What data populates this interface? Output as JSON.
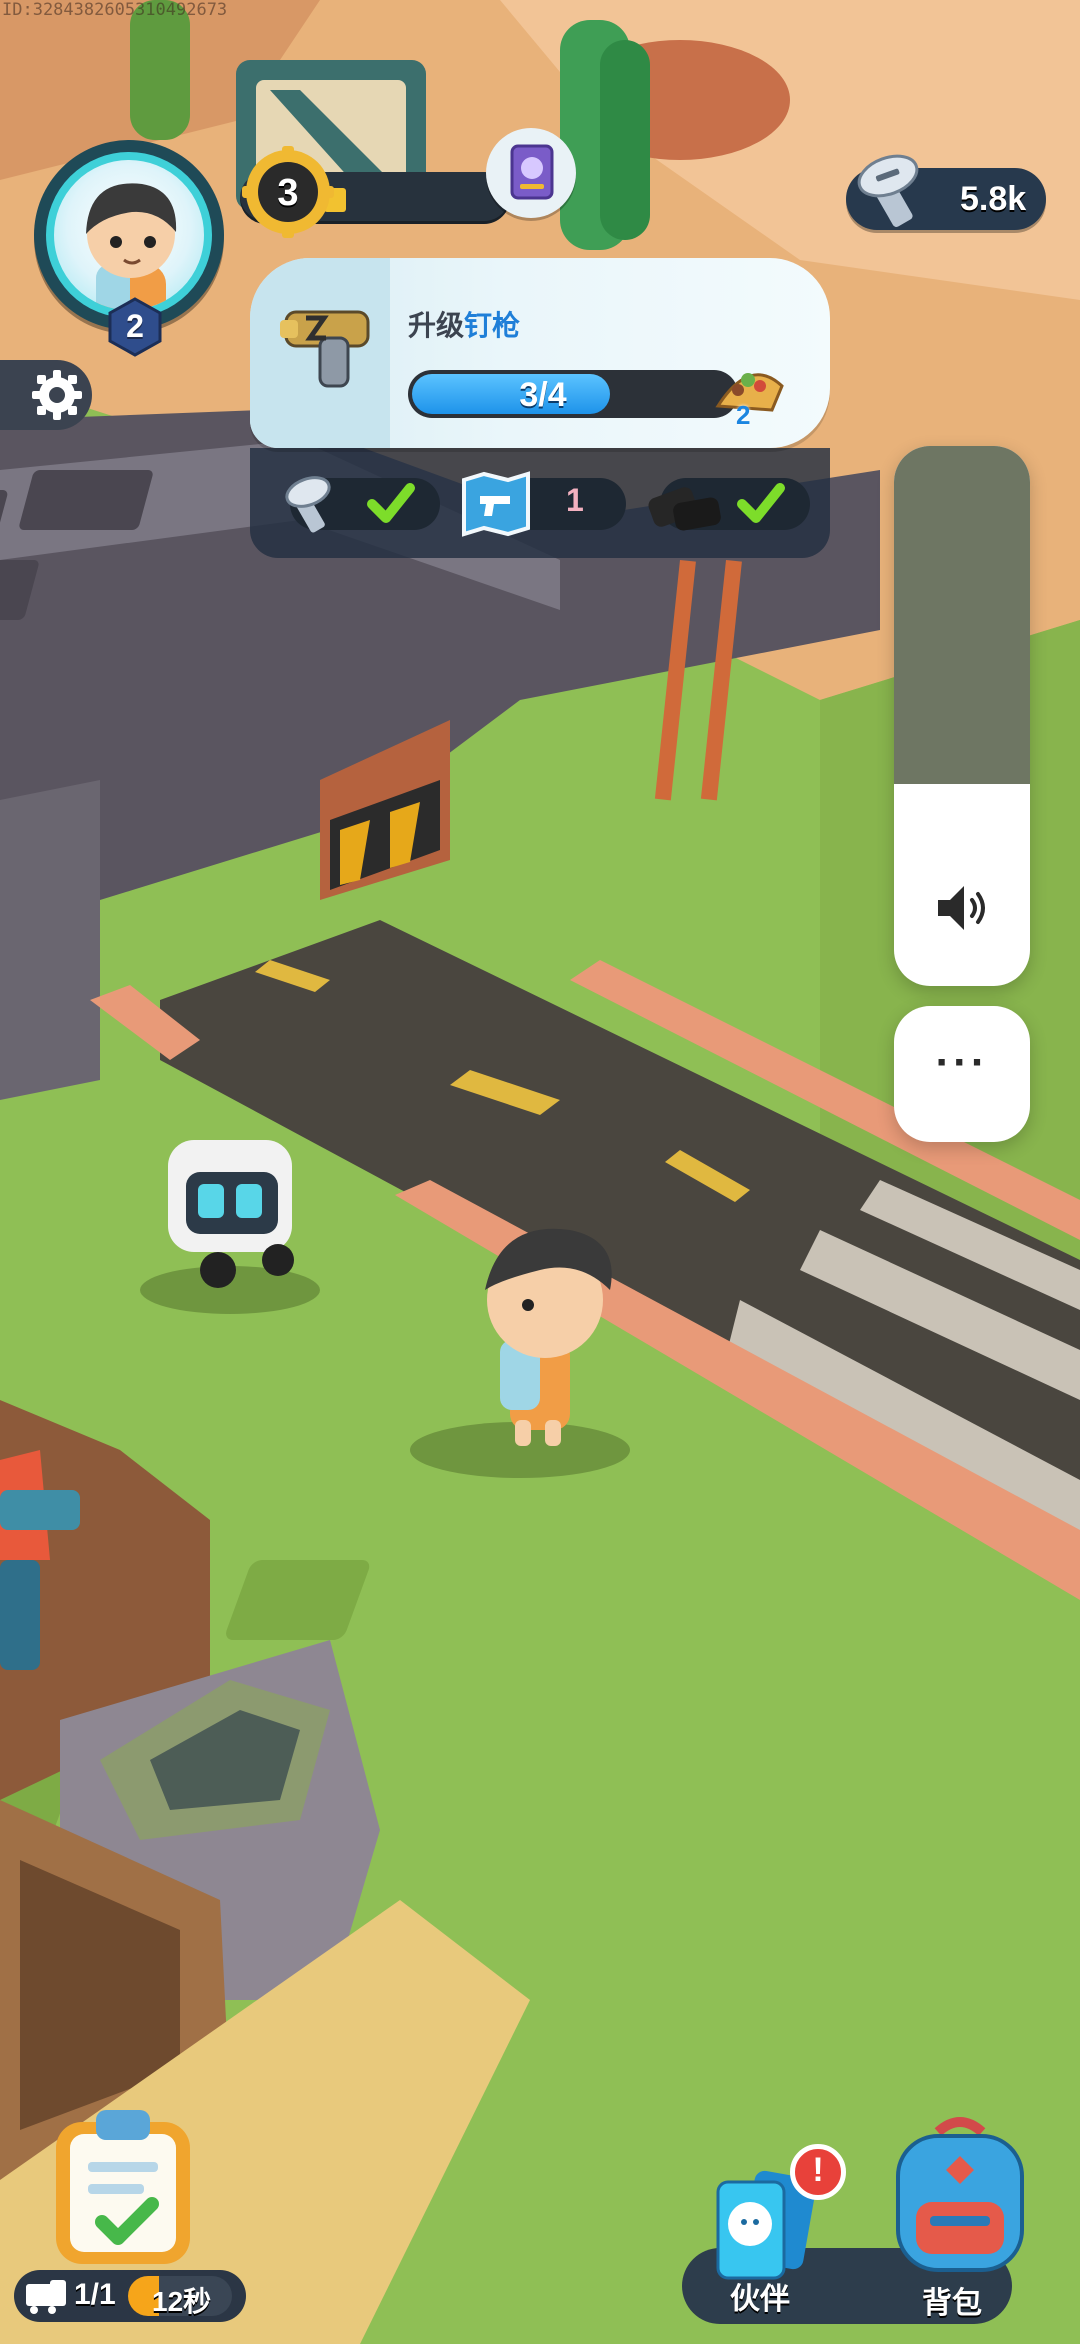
{
  "overlay": {
    "id_text": "ID:3284382605310492673"
  },
  "player": {
    "level": "2",
    "xp_level": "3",
    "xp_progress": 0.08
  },
  "currency": {
    "amount": "5.8k",
    "icon": "screw-icon"
  },
  "quest": {
    "title_prefix": "升级",
    "title_highlight": "钉枪",
    "progress_text": "3/4",
    "progress": 0.75,
    "reward_count": "2",
    "requirements": [
      {
        "icon": "screw-icon",
        "done": true
      },
      {
        "icon": "map-pistol-icon",
        "count": "1"
      },
      {
        "icon": "coal-icon",
        "done": true
      }
    ]
  },
  "volume": {
    "level": 0.35,
    "icon": "speaker-icon"
  },
  "more_button": {
    "label": "···"
  },
  "train": {
    "count": "1/1",
    "timer": "12秒"
  },
  "nav": {
    "partner_label": "伙伴",
    "backpack_label": "背包",
    "alert_mark": "!"
  },
  "colors": {
    "accent_blue": "#1f7fd8",
    "check_green": "#7ddd2a",
    "alert_red": "#e8413a"
  }
}
